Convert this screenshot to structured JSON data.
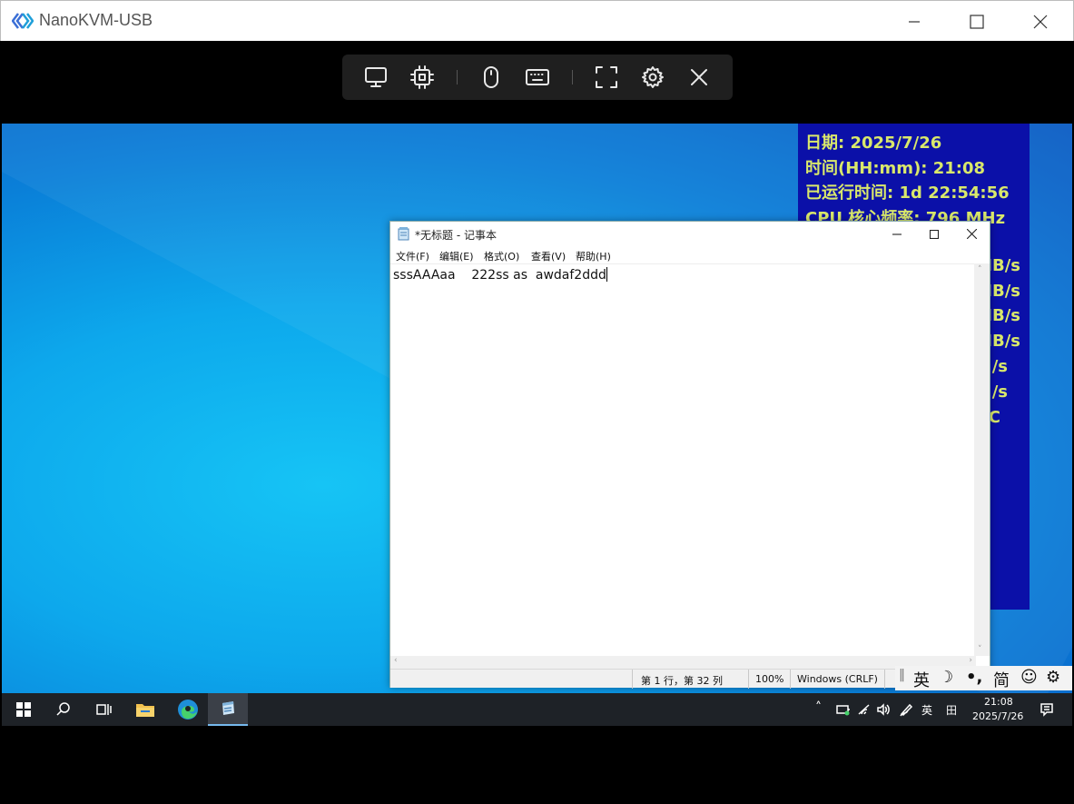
{
  "app": {
    "title": "NanoKVM-USB"
  },
  "toolbar": {
    "buttons": [
      "monitor-icon",
      "chip-icon",
      "mouse-icon",
      "keyboard-icon",
      "fullscreen-icon",
      "gear-icon",
      "close-icon"
    ]
  },
  "sysinfo": {
    "lines": [
      "日期: 2025/7/26",
      "时间(HH:mm): 21:08",
      "已运行时间: 1d 22:54:56",
      "CPU 核心频率: 796 MHz"
    ],
    "partial_right": [
      "MB/s",
      "MB/s",
      "MB/s",
      "MB/s",
      "/s",
      "/s",
      "C"
    ]
  },
  "notepad": {
    "title": "*无标题 - 记事本",
    "menu": [
      "文件(F)",
      "编辑(E)",
      "格式(O)",
      "查看(V)",
      "帮助(H)"
    ],
    "content": "sssAAAaa    222ss as  awdaf2ddd",
    "status": {
      "position": "第 1 行，第 32 列",
      "zoom": "100%",
      "line_ending": "Windows (CRLF)"
    }
  },
  "ime": {
    "lang": "英",
    "moon": "☽",
    "punct": "•,",
    "mode": "简",
    "emoji": "☺",
    "settings": "⚙"
  },
  "taskbar": {
    "tray_lang": "英",
    "tray_ime": "田",
    "time": "21:08",
    "date": "2025/7/26"
  },
  "colors": {
    "sysinfo_bg": "#0b10a8",
    "sysinfo_text": "#d9e86b",
    "taskbar_bg": "#1e2227"
  }
}
